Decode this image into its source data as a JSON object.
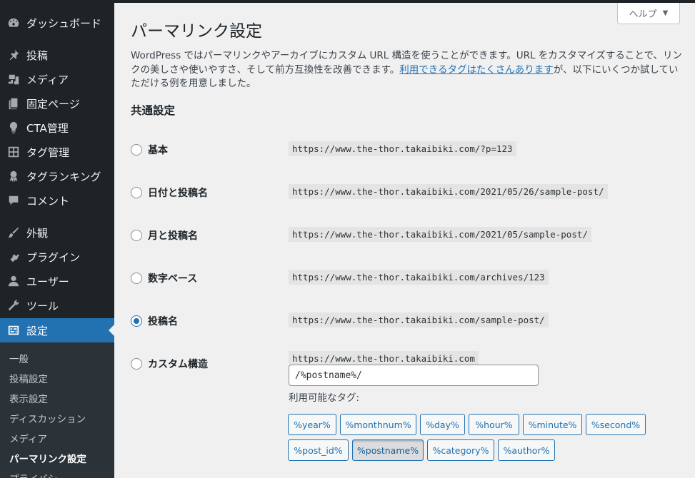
{
  "sidebar": {
    "items": [
      {
        "label": "ダッシュボード",
        "icon": "dashboard-icon"
      },
      {
        "label": "投稿",
        "icon": "pin-icon"
      },
      {
        "label": "メディア",
        "icon": "media-icon"
      },
      {
        "label": "固定ページ",
        "icon": "page-icon"
      },
      {
        "label": "CTA管理",
        "icon": "lightbulb-icon"
      },
      {
        "label": "タグ管理",
        "icon": "layout-icon"
      },
      {
        "label": "タグランキング",
        "icon": "award-icon"
      },
      {
        "label": "コメント",
        "icon": "comment-icon"
      },
      {
        "label": "外観",
        "icon": "brush-icon"
      },
      {
        "label": "プラグイン",
        "icon": "plugin-icon"
      },
      {
        "label": "ユーザー",
        "icon": "user-icon"
      },
      {
        "label": "ツール",
        "icon": "wrench-icon"
      },
      {
        "label": "設定",
        "icon": "settings-icon"
      }
    ],
    "submenu": [
      "一般",
      "投稿設定",
      "表示設定",
      "ディスカッション",
      "メディア",
      "パーマリンク設定",
      "プライバシー"
    ]
  },
  "help": {
    "label": "ヘルプ",
    "arrow": "▼"
  },
  "page": {
    "title": "パーマリンク設定",
    "desc_before": "WordPress ではパーマリンクやアーカイブにカスタム URL 構造を使うことができます。URL をカスタマイズすることで、リンクの美しさや使いやすさ、そして前方互換性を改善できます。",
    "desc_link": "利用できるタグはたくさんあります",
    "desc_after": "が、以下にいくつか試していただける例を用意しました。",
    "section_title": "共通設定"
  },
  "options": [
    {
      "label": "基本",
      "url": "https://www.the-thor.takaibiki.com/?p=123",
      "checked": false
    },
    {
      "label": "日付と投稿名",
      "url": "https://www.the-thor.takaibiki.com/2021/05/26/sample-post/",
      "checked": false
    },
    {
      "label": "月と投稿名",
      "url": "https://www.the-thor.takaibiki.com/2021/05/sample-post/",
      "checked": false
    },
    {
      "label": "数字ベース",
      "url": "https://www.the-thor.takaibiki.com/archives/123",
      "checked": false
    },
    {
      "label": "投稿名",
      "url": "https://www.the-thor.takaibiki.com/sample-post/",
      "checked": true
    },
    {
      "label": "カスタム構造",
      "url": "https://www.the-thor.takaibiki.com",
      "checked": false
    }
  ],
  "custom": {
    "value": "/%postname%/",
    "tags_label": "利用可能なタグ:",
    "tags": [
      "%year%",
      "%monthnum%",
      "%day%",
      "%hour%",
      "%minute%",
      "%second%",
      "%post_id%",
      "%postname%",
      "%category%",
      "%author%"
    ],
    "active_tag": "%postname%"
  },
  "colors": {
    "sidebar": "#1d2327",
    "accent": "#2271b1",
    "background": "#f0f0f1"
  }
}
